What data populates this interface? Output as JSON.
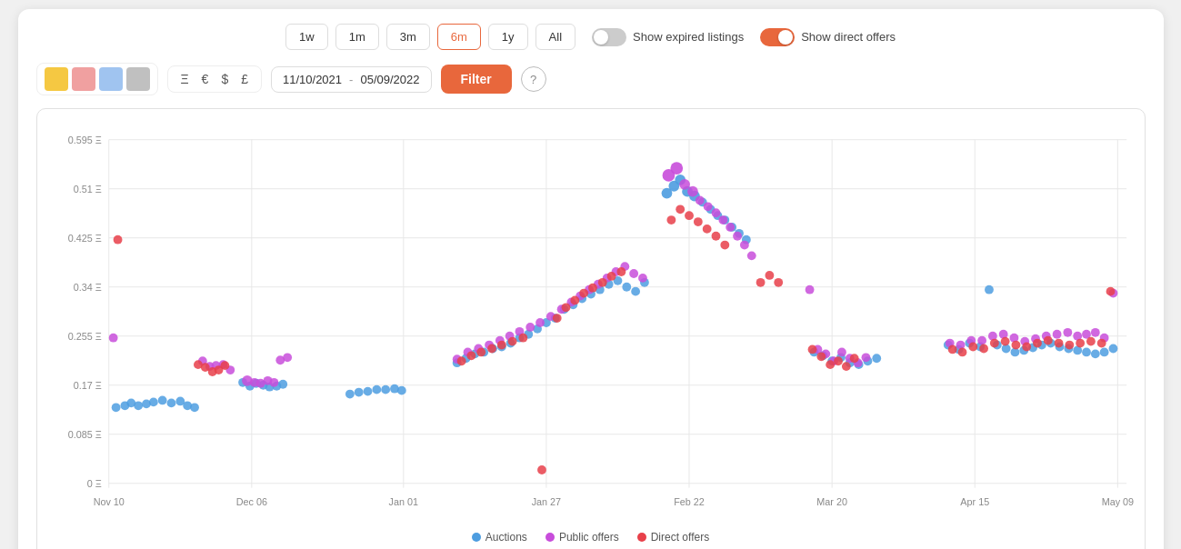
{
  "timeButtons": [
    {
      "label": "1w",
      "active": false
    },
    {
      "label": "1m",
      "active": false
    },
    {
      "label": "3m",
      "active": false
    },
    {
      "label": "6m",
      "active": true
    },
    {
      "label": "1y",
      "active": false
    },
    {
      "label": "All",
      "active": false
    }
  ],
  "toggles": {
    "expiredListings": {
      "label": "Show expired listings",
      "on": false
    },
    "directOffers": {
      "label": "Show direct offers",
      "on": true
    }
  },
  "filterBar": {
    "icons": [
      "gold",
      "pink",
      "blue",
      "gray"
    ],
    "currencies": [
      "Ξ",
      "€",
      "$",
      "£"
    ],
    "dateStart": "11/10/2021",
    "dateEnd": "05/09/2022",
    "filterLabel": "Filter",
    "helpLabel": "?"
  },
  "chart": {
    "yLabels": [
      "0.595 Ξ",
      "0.51 Ξ",
      "0.425 Ξ",
      "0.34 Ξ",
      "0.255 Ξ",
      "0.17 Ξ",
      "0.085 Ξ",
      "0 Ξ"
    ],
    "xLabels": [
      "Nov 10",
      "Dec 06",
      "Jan 01",
      "Jan 27",
      "Feb 22",
      "Mar 20",
      "Apr 15",
      "May 09"
    ]
  },
  "legend": {
    "auctions": {
      "label": "Auctions",
      "color": "#4d9de0"
    },
    "publicOffers": {
      "label": "Public offers",
      "color": "#c84ddb"
    },
    "directOffers": {
      "label": "Direct offers",
      "color": "#e8404a"
    }
  }
}
